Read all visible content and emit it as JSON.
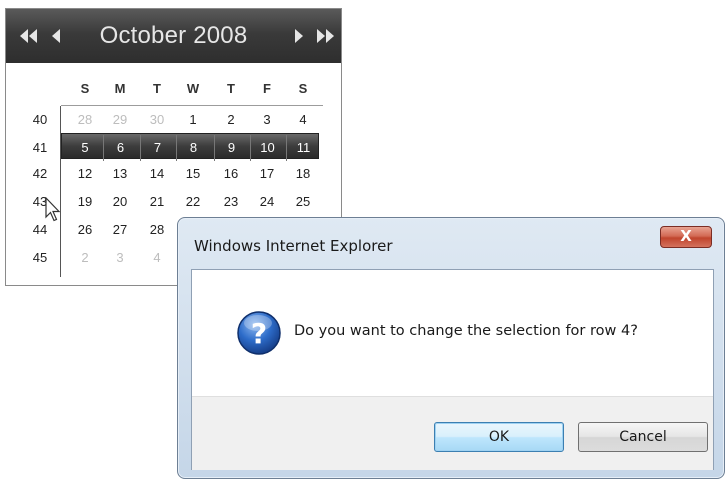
{
  "calendar": {
    "title": "October 2008",
    "nav": {
      "prev_year": "double-left-arrow-icon",
      "prev_month": "left-arrow-icon",
      "next_month": "right-arrow-icon",
      "next_year": "double-right-arrow-icon"
    },
    "day_headers": [
      "S",
      "M",
      "T",
      "W",
      "T",
      "F",
      "S"
    ],
    "weeks": [
      {
        "week": "40",
        "days": [
          {
            "d": "28",
            "other": true
          },
          {
            "d": "29",
            "other": true
          },
          {
            "d": "30",
            "other": true
          },
          {
            "d": "1"
          },
          {
            "d": "2"
          },
          {
            "d": "3"
          },
          {
            "d": "4"
          }
        ]
      },
      {
        "week": "41",
        "selected": true,
        "days": [
          {
            "d": "5"
          },
          {
            "d": "6"
          },
          {
            "d": "7"
          },
          {
            "d": "8"
          },
          {
            "d": "9"
          },
          {
            "d": "10"
          },
          {
            "d": "11"
          }
        ]
      },
      {
        "week": "42",
        "days": [
          {
            "d": "12"
          },
          {
            "d": "13"
          },
          {
            "d": "14"
          },
          {
            "d": "15"
          },
          {
            "d": "16"
          },
          {
            "d": "17"
          },
          {
            "d": "18"
          }
        ]
      },
      {
        "week": "43",
        "days": [
          {
            "d": "19"
          },
          {
            "d": "20"
          },
          {
            "d": "21"
          },
          {
            "d": "22"
          },
          {
            "d": "23"
          },
          {
            "d": "24"
          },
          {
            "d": "25"
          }
        ]
      },
      {
        "week": "44",
        "days": [
          {
            "d": "26"
          },
          {
            "d": "27"
          },
          {
            "d": "28"
          },
          {
            "d": ""
          },
          {
            "d": ""
          },
          {
            "d": ""
          },
          {
            "d": ""
          }
        ]
      },
      {
        "week": "45",
        "days": [
          {
            "d": "2",
            "other": true
          },
          {
            "d": "3",
            "other": true
          },
          {
            "d": "4",
            "other": true
          },
          {
            "d": ""
          },
          {
            "d": ""
          },
          {
            "d": ""
          },
          {
            "d": ""
          }
        ]
      }
    ]
  },
  "dialog": {
    "title": "Windows Internet Explorer",
    "close_label": "X",
    "icon": "question-icon",
    "message": "Do you want to change the selection for row 4?",
    "ok_label": "OK",
    "cancel_label": "Cancel"
  }
}
